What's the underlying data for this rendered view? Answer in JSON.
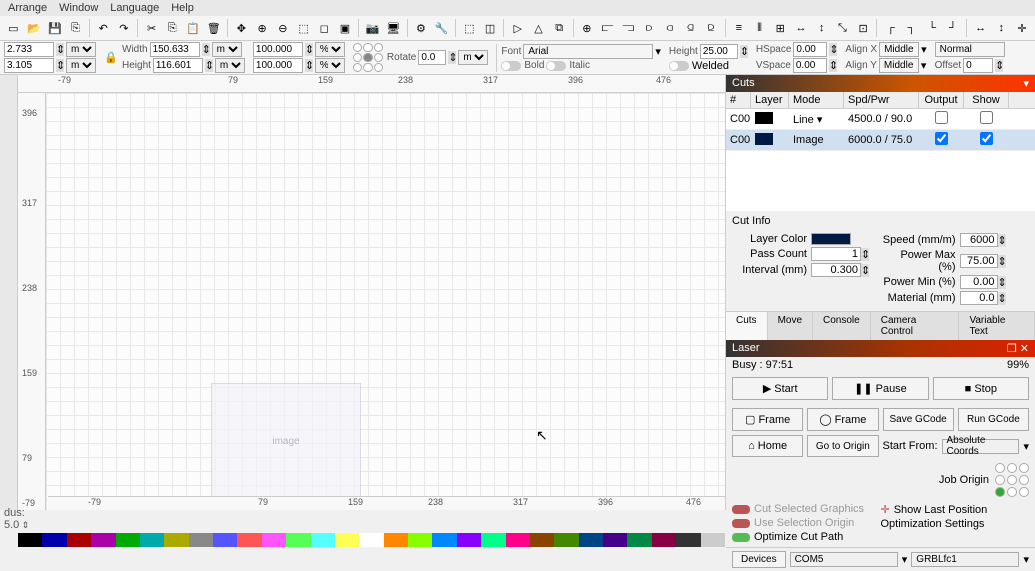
{
  "menu": {
    "items": [
      "Arrange",
      "Window",
      "Language",
      "Help"
    ]
  },
  "props": {
    "x": "2.733",
    "y": "3.105",
    "width_label": "Width",
    "width": "150.633",
    "height_label": "Height",
    "height": "116.601",
    "pct1": "100.000",
    "pct2": "100.000",
    "unit": "mm",
    "pct": "%",
    "rotate_label": "Rotate",
    "rotate": "0.0"
  },
  "font": {
    "label": "Font",
    "family": "Arial",
    "height_label": "Height",
    "height": "25.00",
    "hspace_label": "HSpace",
    "hspace": "0.00",
    "vspace_label": "VSpace",
    "vspace": "0.00",
    "bold": "Bold",
    "italic": "Italic",
    "welded": "Welded",
    "alignx_label": "Align X",
    "alignx": "Middle",
    "aligny_label": "Align Y",
    "aligny": "Middle",
    "normal": "Normal",
    "offset_label": "Offset",
    "offset": "0"
  },
  "ruler": {
    "h": [
      "-79",
      "79",
      "159",
      "238",
      "317",
      "396",
      "476"
    ],
    "v": [
      "396",
      "317",
      "238",
      "159",
      "79",
      "-79"
    ]
  },
  "cuts": {
    "title": "Cuts",
    "headers": {
      "num": "#",
      "layer": "Layer",
      "mode": "Mode",
      "spd": "Spd/Pwr",
      "output": "Output",
      "show": "Show"
    },
    "rows": [
      {
        "num": "C00",
        "color": "#000000",
        "mode": "Line",
        "spd": "4500.0 / 90.0",
        "output": false,
        "show": false
      },
      {
        "num": "C00",
        "color": "#001a44",
        "mode": "Image",
        "spd": "6000.0 / 75.0",
        "output": true,
        "show": true
      }
    ]
  },
  "cutinfo": {
    "title": "Cut Info",
    "layer_color": "Layer Color",
    "pass_count": "Pass Count",
    "pass_count_v": "1",
    "interval": "Interval (mm)",
    "interval_v": "0.300",
    "speed": "Speed (mm/m)",
    "speed_v": "6000",
    "pmax": "Power Max (%)",
    "pmax_v": "75.00",
    "pmin": "Power Min (%)",
    "pmin_v": "0.00",
    "material": "Material (mm)",
    "material_v": "0.0"
  },
  "tabs": [
    "Cuts",
    "Move",
    "Console",
    "Camera Control",
    "Variable Text"
  ],
  "laser": {
    "title": "Laser",
    "busy": "Busy : 97:51",
    "pct": "99%",
    "start": "Start",
    "pause": "Pause",
    "stop": "Stop",
    "frame_rect": "Frame",
    "frame_circ": "Frame",
    "save_gcode": "Save GCode",
    "run_gcode": "Run GCode",
    "home": "Home",
    "go_origin": "Go to Origin",
    "start_from": "Start From:",
    "start_from_v": "Absolute Coords",
    "job_origin": "Job Origin",
    "cut_sel": "Cut Selected Graphics",
    "use_sel": "Use Selection Origin",
    "opt_path": "Optimize Cut Path",
    "show_last": "Show Last Position",
    "opt_settings": "Optimization Settings",
    "devices": "Devices",
    "com": "COM5",
    "grbl": "GRBLfc1"
  },
  "status": {
    "radius": "dus:",
    "radius_v": "5.0"
  },
  "palette": [
    "#000",
    "#0000aa",
    "#aa0000",
    "#aa00aa",
    "#00aa00",
    "#00aaaa",
    "#aaaa00",
    "#888",
    "#5555ff",
    "#ff5555",
    "#ff55ff",
    "#55ff55",
    "#55ffff",
    "#ffff55",
    "#fff",
    "#ff8800",
    "#88ff00",
    "#0088ff",
    "#8800ff",
    "#00ff88",
    "#ff0088",
    "#884400",
    "#448800",
    "#004488",
    "#440088",
    "#008844",
    "#880044",
    "#333",
    "#ccc"
  ]
}
